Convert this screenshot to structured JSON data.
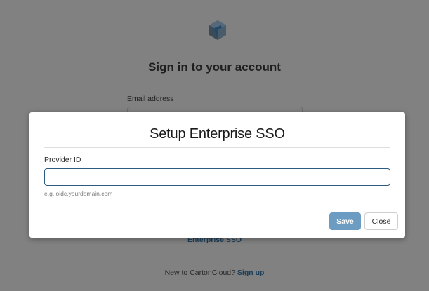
{
  "background_page": {
    "logo_icon": "cartoncloud-logo-icon",
    "title": "Sign in to your account",
    "email_label": "Email address",
    "enterprise_sso_link": "Enterprise SSO",
    "signup_prompt": "New to CartonCloud?",
    "signup_link": "Sign up"
  },
  "modal": {
    "title": "Setup Enterprise SSO",
    "field_label": "Provider ID",
    "input_value": "",
    "hint": "e.g. oidc.yourdomain.com",
    "save_label": "Save",
    "close_label": "Close"
  },
  "colors": {
    "overlay_background": "#818181",
    "link": "#1d3e57",
    "input_focus_border": "#2d5b80",
    "save_button": "#6d9cc2",
    "modal_background": "#ffffff"
  }
}
